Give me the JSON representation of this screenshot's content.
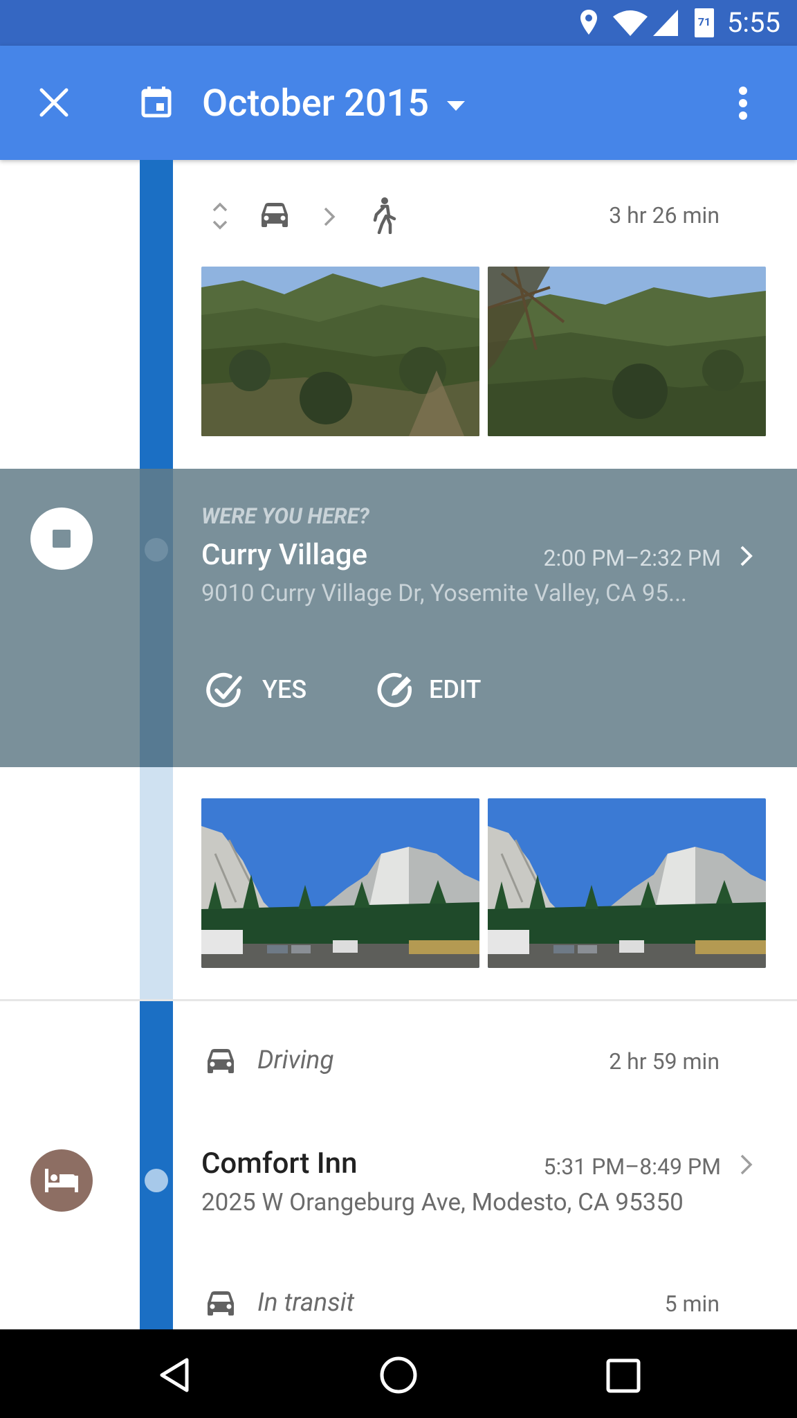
{
  "status_bar": {
    "time": "5:55",
    "battery": "71"
  },
  "toolbar": {
    "title": "October 2015"
  },
  "segment_top": {
    "duration": "3 hr 26 min"
  },
  "visit_unconfirmed": {
    "prompt": "WERE YOU HERE?",
    "place": "Curry Village",
    "time_range": "2:00 PM–2:32 PM",
    "address": "9010 Curry Village Dr, Yosemite Valley, CA 95...",
    "yes_label": "YES",
    "edit_label": "EDIT"
  },
  "segment_driving": {
    "mode": "Driving",
    "duration": "2 hr 59 min"
  },
  "visit_confirmed": {
    "place": "Comfort Inn",
    "time_range": "5:31 PM–8:49 PM",
    "address": "2025 W Orangeburg Ave, Modesto, CA 95350"
  },
  "segment_transit": {
    "mode": "In transit",
    "duration": "5 min"
  },
  "colors": {
    "status_bar": "#3567c2",
    "toolbar": "#4685e8",
    "timeline": "#1b6fc4",
    "visit_banner": "#7a909a",
    "hotel_icon": "#8d6e63"
  },
  "icons": [
    "close-icon",
    "calendar-icon",
    "dropdown-arrow-icon",
    "more-vert-icon",
    "car-icon",
    "walk-icon",
    "check-circle-icon",
    "edit-icon",
    "hotel-icon",
    "back-icon",
    "home-icon",
    "recents-icon"
  ]
}
